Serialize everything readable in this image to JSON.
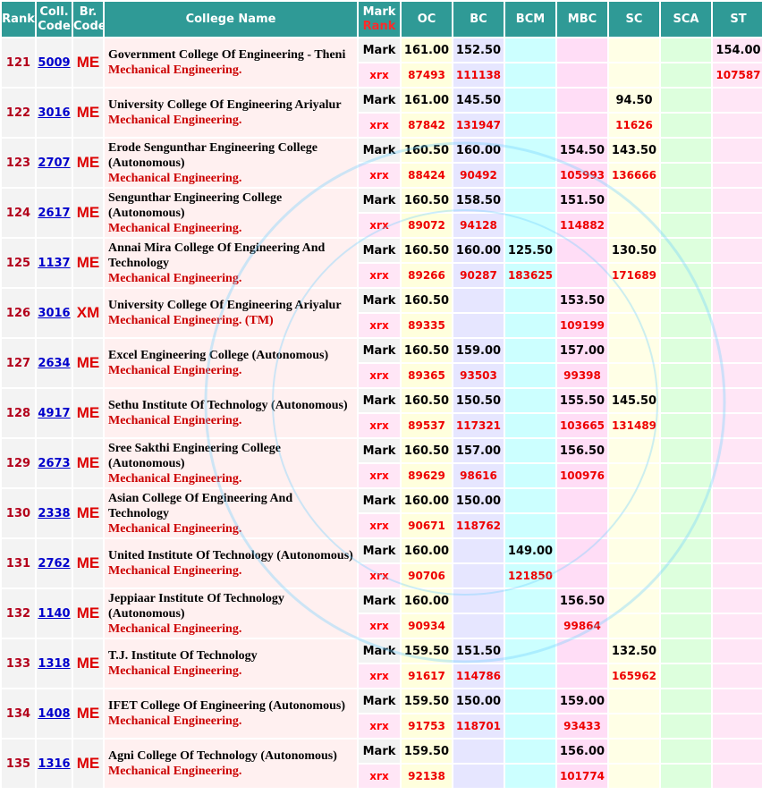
{
  "header": {
    "rank": "Rank",
    "coll_code": "Coll. Code",
    "br_code": "Br. Code",
    "college_name": "College Name",
    "mark": "Mark",
    "rank_sub": "Rank",
    "oc": "OC",
    "bc": "BC",
    "bcm": "BCM",
    "mbc": "MBC",
    "sc": "SC",
    "sca": "SCA",
    "st": "ST"
  },
  "labels": {
    "mark": "Mark",
    "rank": "xrx"
  },
  "rows": [
    {
      "rank": "121",
      "code": "5009",
      "br": "ME",
      "name": "Government College Of Engineering - Theni",
      "branch": "Mechanical Engineering.",
      "m": {
        "oc": "161.00",
        "bc": "152.50",
        "bcm": "",
        "mbc": "",
        "sc": "",
        "sca": "",
        "st": "154.00"
      },
      "r": {
        "oc": "87493",
        "bc": "111138",
        "bcm": "",
        "mbc": "",
        "sc": "",
        "sca": "",
        "st": "107587"
      }
    },
    {
      "rank": "122",
      "code": "3016",
      "br": "ME",
      "name": "University College Of Engineering Ariyalur",
      "branch": "Mechanical Engineering.",
      "m": {
        "oc": "161.00",
        "bc": "145.50",
        "bcm": "",
        "mbc": "",
        "sc": "94.50",
        "sca": "",
        "st": ""
      },
      "r": {
        "oc": "87842",
        "bc": "131947",
        "bcm": "",
        "mbc": "",
        "sc": "11626",
        "sca": "",
        "st": ""
      }
    },
    {
      "rank": "123",
      "code": "2707",
      "br": "ME",
      "name": "Erode Sengunthar Engineering College (Autonomous)",
      "branch": "Mechanical Engineering.",
      "m": {
        "oc": "160.50",
        "bc": "160.00",
        "bcm": "",
        "mbc": "154.50",
        "sc": "143.50",
        "sca": "",
        "st": ""
      },
      "r": {
        "oc": "88424",
        "bc": "90492",
        "bcm": "",
        "mbc": "105993",
        "sc": "136666",
        "sca": "",
        "st": ""
      }
    },
    {
      "rank": "124",
      "code": "2617",
      "br": "ME",
      "name": "Sengunthar Engineering College (Autonomous)",
      "branch": "Mechanical Engineering.",
      "m": {
        "oc": "160.50",
        "bc": "158.50",
        "bcm": "",
        "mbc": "151.50",
        "sc": "",
        "sca": "",
        "st": ""
      },
      "r": {
        "oc": "89072",
        "bc": "94128",
        "bcm": "",
        "mbc": "114882",
        "sc": "",
        "sca": "",
        "st": ""
      }
    },
    {
      "rank": "125",
      "code": "1137",
      "br": "ME",
      "name": "Annai Mira College Of Engineering And Technology",
      "branch": "Mechanical Engineering.",
      "m": {
        "oc": "160.50",
        "bc": "160.00",
        "bcm": "125.50",
        "mbc": "",
        "sc": "130.50",
        "sca": "",
        "st": ""
      },
      "r": {
        "oc": "89266",
        "bc": "90287",
        "bcm": "183625",
        "mbc": "",
        "sc": "171689",
        "sca": "",
        "st": ""
      }
    },
    {
      "rank": "126",
      "code": "3016",
      "br": "XM",
      "name": "University College Of Engineering Ariyalur",
      "branch": "Mechanical Engineering. (TM)",
      "m": {
        "oc": "160.50",
        "bc": "",
        "bcm": "",
        "mbc": "153.50",
        "sc": "",
        "sca": "",
        "st": ""
      },
      "r": {
        "oc": "89335",
        "bc": "",
        "bcm": "",
        "mbc": "109199",
        "sc": "",
        "sca": "",
        "st": ""
      }
    },
    {
      "rank": "127",
      "code": "2634",
      "br": "ME",
      "name": "Excel Engineering College (Autonomous)",
      "branch": "Mechanical Engineering.",
      "m": {
        "oc": "160.50",
        "bc": "159.00",
        "bcm": "",
        "mbc": "157.00",
        "sc": "",
        "sca": "",
        "st": ""
      },
      "r": {
        "oc": "89365",
        "bc": "93503",
        "bcm": "",
        "mbc": "99398",
        "sc": "",
        "sca": "",
        "st": ""
      }
    },
    {
      "rank": "128",
      "code": "4917",
      "br": "ME",
      "name": "Sethu Institute Of Technology (Autonomous)",
      "branch": "Mechanical Engineering.",
      "m": {
        "oc": "160.50",
        "bc": "150.50",
        "bcm": "",
        "mbc": "155.50",
        "sc": "145.50",
        "sca": "",
        "st": ""
      },
      "r": {
        "oc": "89537",
        "bc": "117321",
        "bcm": "",
        "mbc": "103665",
        "sc": "131489",
        "sca": "",
        "st": ""
      }
    },
    {
      "rank": "129",
      "code": "2673",
      "br": "ME",
      "name": "Sree Sakthi Engineering College (Autonomous)",
      "branch": "Mechanical Engineering.",
      "m": {
        "oc": "160.50",
        "bc": "157.00",
        "bcm": "",
        "mbc": "156.50",
        "sc": "",
        "sca": "",
        "st": ""
      },
      "r": {
        "oc": "89629",
        "bc": "98616",
        "bcm": "",
        "mbc": "100976",
        "sc": "",
        "sca": "",
        "st": ""
      }
    },
    {
      "rank": "130",
      "code": "2338",
      "br": "ME",
      "name": "Asian College Of Engineering And Technology",
      "branch": "Mechanical Engineering.",
      "m": {
        "oc": "160.00",
        "bc": "150.00",
        "bcm": "",
        "mbc": "",
        "sc": "",
        "sca": "",
        "st": ""
      },
      "r": {
        "oc": "90671",
        "bc": "118762",
        "bcm": "",
        "mbc": "",
        "sc": "",
        "sca": "",
        "st": ""
      }
    },
    {
      "rank": "131",
      "code": "2762",
      "br": "ME",
      "name": "United Institute Of Technology (Autonomous)",
      "branch": "Mechanical Engineering.",
      "m": {
        "oc": "160.00",
        "bc": "",
        "bcm": "149.00",
        "mbc": "",
        "sc": "",
        "sca": "",
        "st": ""
      },
      "r": {
        "oc": "90706",
        "bc": "",
        "bcm": "121850",
        "mbc": "",
        "sc": "",
        "sca": "",
        "st": ""
      }
    },
    {
      "rank": "132",
      "code": "1140",
      "br": "ME",
      "name": "Jeppiaar Institute Of Technology (Autonomous)",
      "branch": "Mechanical Engineering.",
      "m": {
        "oc": "160.00",
        "bc": "",
        "bcm": "",
        "mbc": "156.50",
        "sc": "",
        "sca": "",
        "st": ""
      },
      "r": {
        "oc": "90934",
        "bc": "",
        "bcm": "",
        "mbc": "99864",
        "sc": "",
        "sca": "",
        "st": ""
      }
    },
    {
      "rank": "133",
      "code": "1318",
      "br": "ME",
      "name": "T.J. Institute Of Technology",
      "branch": "Mechanical Engineering.",
      "m": {
        "oc": "159.50",
        "bc": "151.50",
        "bcm": "",
        "mbc": "",
        "sc": "132.50",
        "sca": "",
        "st": ""
      },
      "r": {
        "oc": "91617",
        "bc": "114786",
        "bcm": "",
        "mbc": "",
        "sc": "165962",
        "sca": "",
        "st": ""
      }
    },
    {
      "rank": "134",
      "code": "1408",
      "br": "ME",
      "name": "IFET College Of Engineering (Autonomous)",
      "branch": "Mechanical Engineering.",
      "m": {
        "oc": "159.50",
        "bc": "150.00",
        "bcm": "",
        "mbc": "159.00",
        "sc": "",
        "sca": "",
        "st": ""
      },
      "r": {
        "oc": "91753",
        "bc": "118701",
        "bcm": "",
        "mbc": "93433",
        "sc": "",
        "sca": "",
        "st": ""
      }
    },
    {
      "rank": "135",
      "code": "1316",
      "br": "ME",
      "name": "Agni College Of Technology (Autonomous)",
      "branch": "Mechanical Engineering.",
      "m": {
        "oc": "159.50",
        "bc": "",
        "bcm": "",
        "mbc": "156.00",
        "sc": "",
        "sca": "",
        "st": ""
      },
      "r": {
        "oc": "92138",
        "bc": "",
        "bcm": "",
        "mbc": "101774",
        "sc": "",
        "sca": "",
        "st": ""
      }
    }
  ]
}
